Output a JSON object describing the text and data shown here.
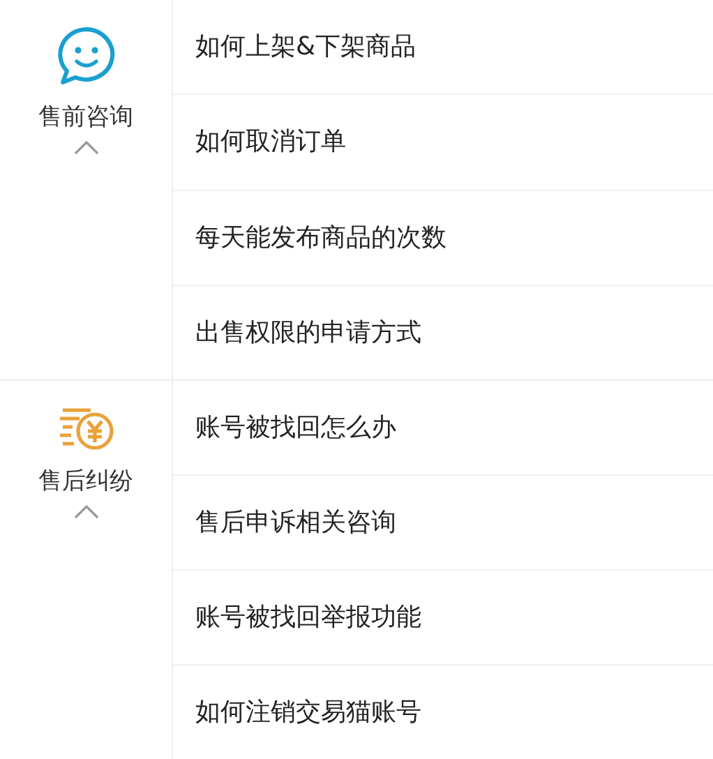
{
  "sections": [
    {
      "title": "售前咨询",
      "kind": "chat",
      "expanded": true,
      "items": [
        "如何上架&下架商品",
        "如何取消订单",
        "每天能发布商品的次数",
        "出售权限的申请方式"
      ]
    },
    {
      "title": "售后纠纷",
      "kind": "money",
      "expanded": true,
      "items": [
        "账号被找回怎么办",
        "售后申诉相关咨询",
        "账号被找回举报功能",
        "如何注销交易猫账号"
      ]
    }
  ]
}
